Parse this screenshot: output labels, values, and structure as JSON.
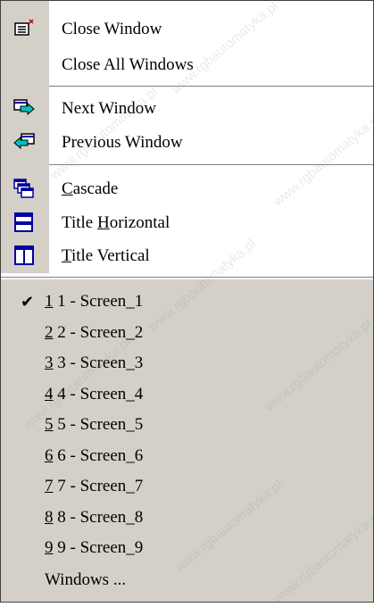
{
  "menu": {
    "close_window": "Close Window",
    "close_all_windows": "Close All Windows",
    "next_window": "Next Window",
    "previous_window": "Previous Window",
    "cascade": "Cascade",
    "title_horizontal": "Title Horizontal",
    "title_vertical": "Title Vertical"
  },
  "windows": [
    {
      "key": "1",
      "label": "1 - Screen_1",
      "checked": true
    },
    {
      "key": "2",
      "label": "2 - Screen_2"
    },
    {
      "key": "3",
      "label": "3 - Screen_3"
    },
    {
      "key": "4",
      "label": "4 - Screen_4"
    },
    {
      "key": "5",
      "label": "5 - Screen_5"
    },
    {
      "key": "6",
      "label": "6 - Screen_6"
    },
    {
      "key": "7",
      "label": "7 - Screen_7"
    },
    {
      "key": "8",
      "label": "8 - Screen_8"
    },
    {
      "key": "9",
      "label": "9 - Screen_9"
    }
  ],
  "windows_more": "Windows ...",
  "watermark": "www.rgbautomatyka.pl",
  "colors": {
    "menu_bg": "#d4d0c8",
    "icon_blue": "#0000a0",
    "icon_cyan": "#00c0c0"
  }
}
